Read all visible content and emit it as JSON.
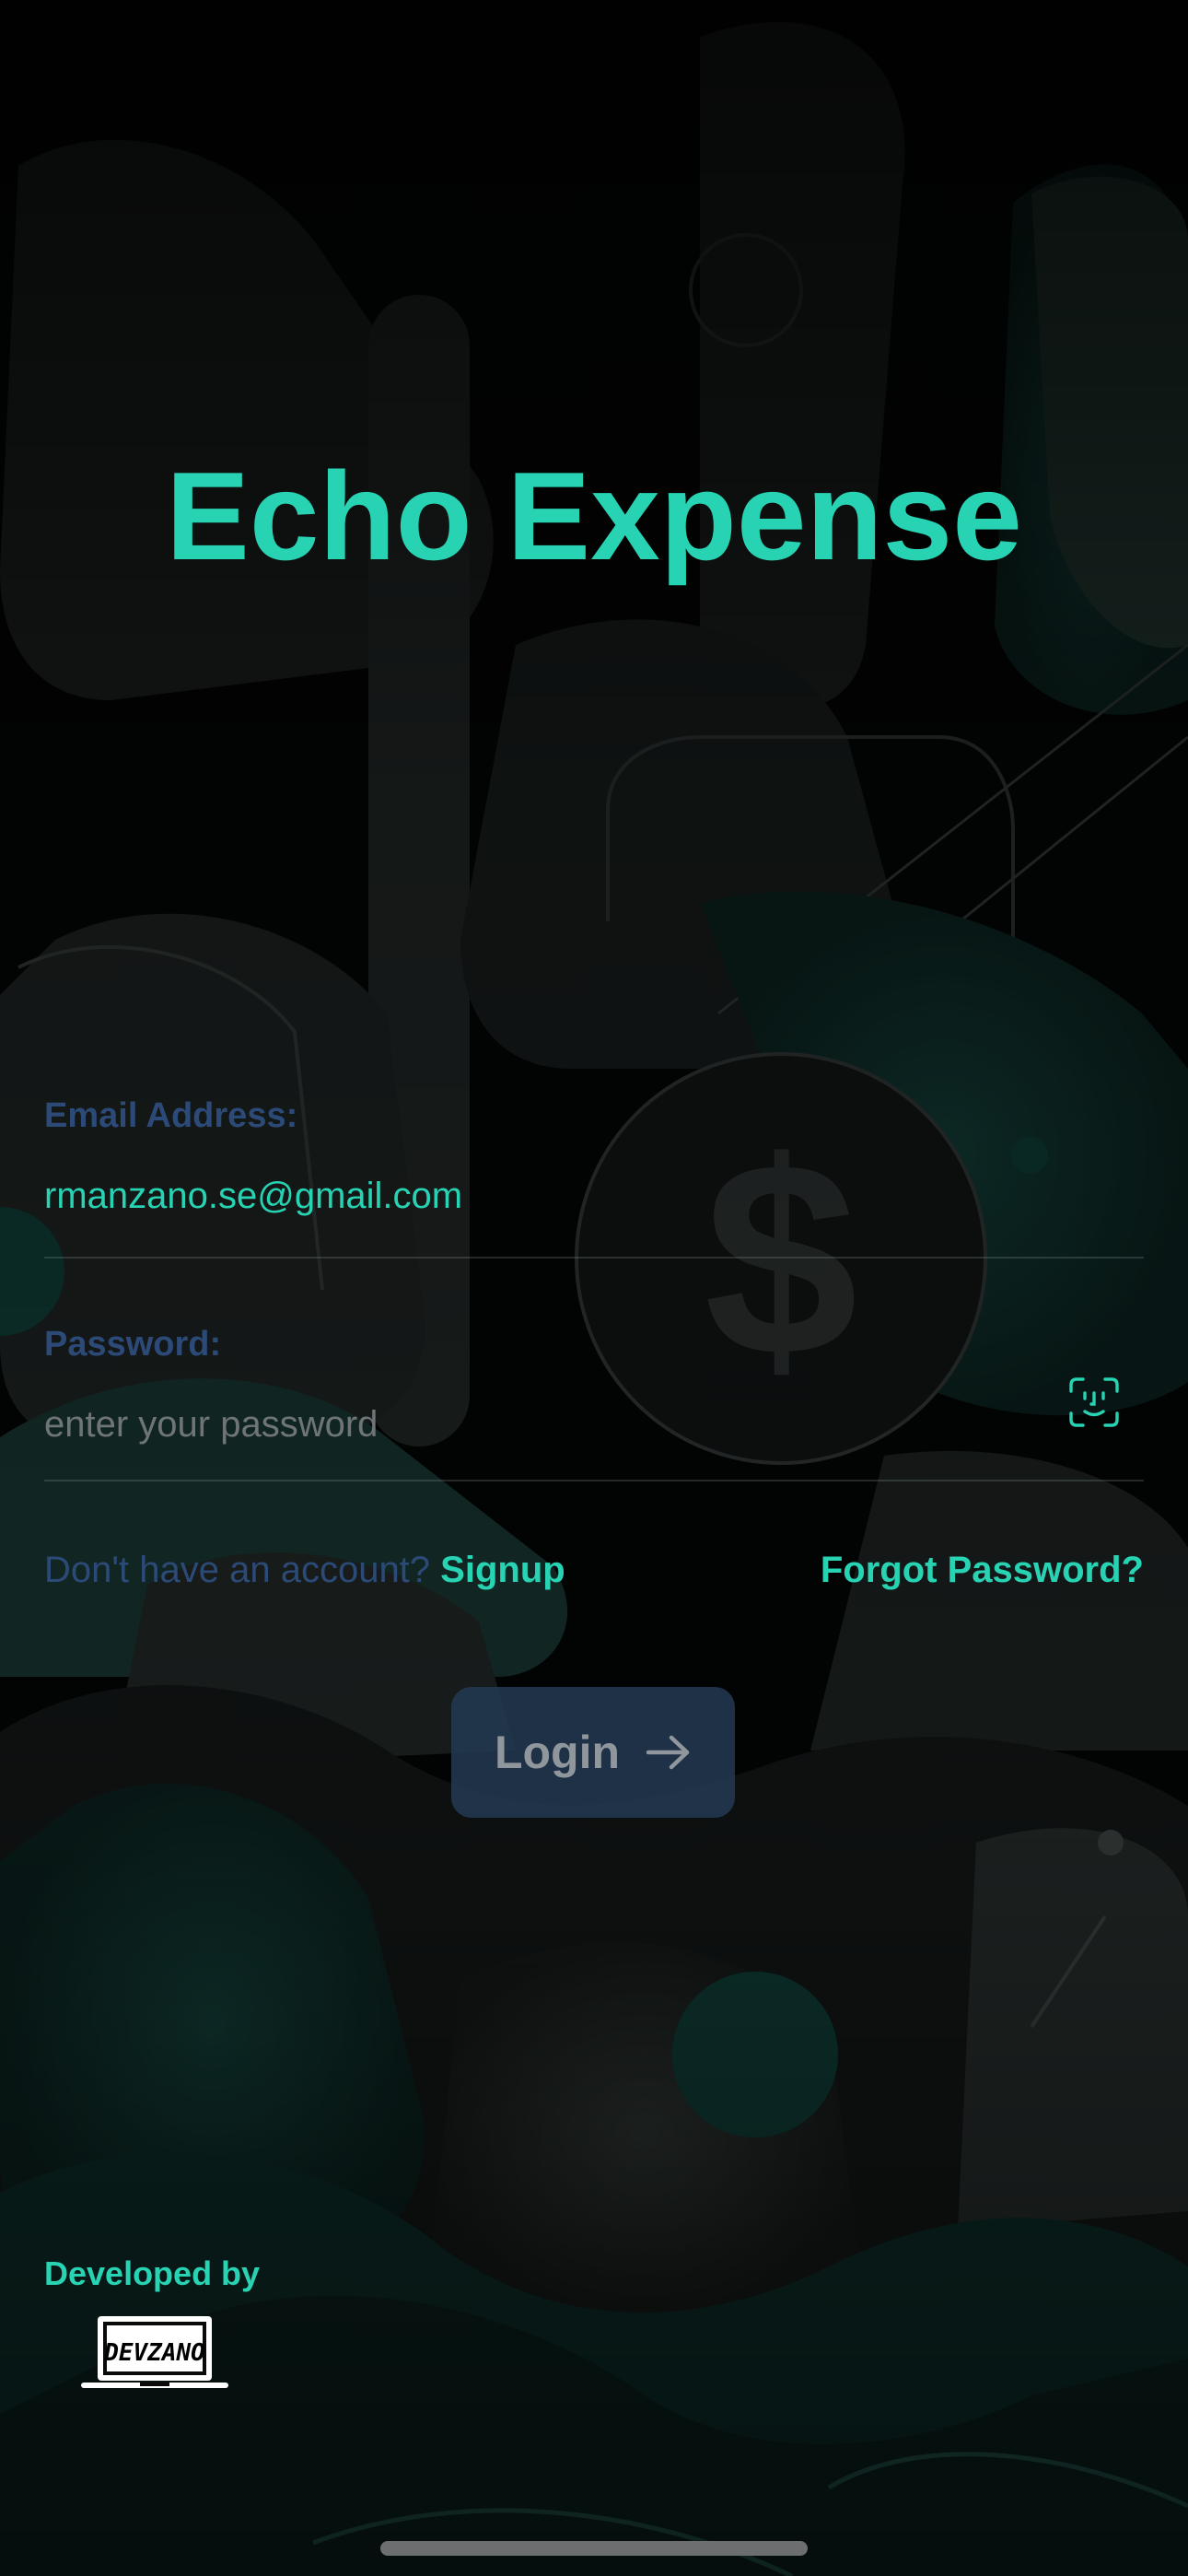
{
  "app": {
    "title": "Echo Expense"
  },
  "form": {
    "email_label": "Email Address:",
    "email_value": "rmanzano.se@gmail.com",
    "password_label": "Password:",
    "password_placeholder": "enter your password",
    "signup_prompt": "Don't have an account?",
    "signup_link": "Signup",
    "forgot_link": "Forgot Password?",
    "login_label": "Login"
  },
  "footer": {
    "developed_by": "Developed by",
    "logo_text": "DEVZANO"
  },
  "icons": {
    "faceid": "face-id-icon",
    "login_arrow": "arrow-right-icon",
    "dollar": "dollar-coin-icon"
  },
  "colors": {
    "accent": "#27d3b3",
    "label": "#2c4a78",
    "background": "#030404",
    "button": "#233a52"
  }
}
